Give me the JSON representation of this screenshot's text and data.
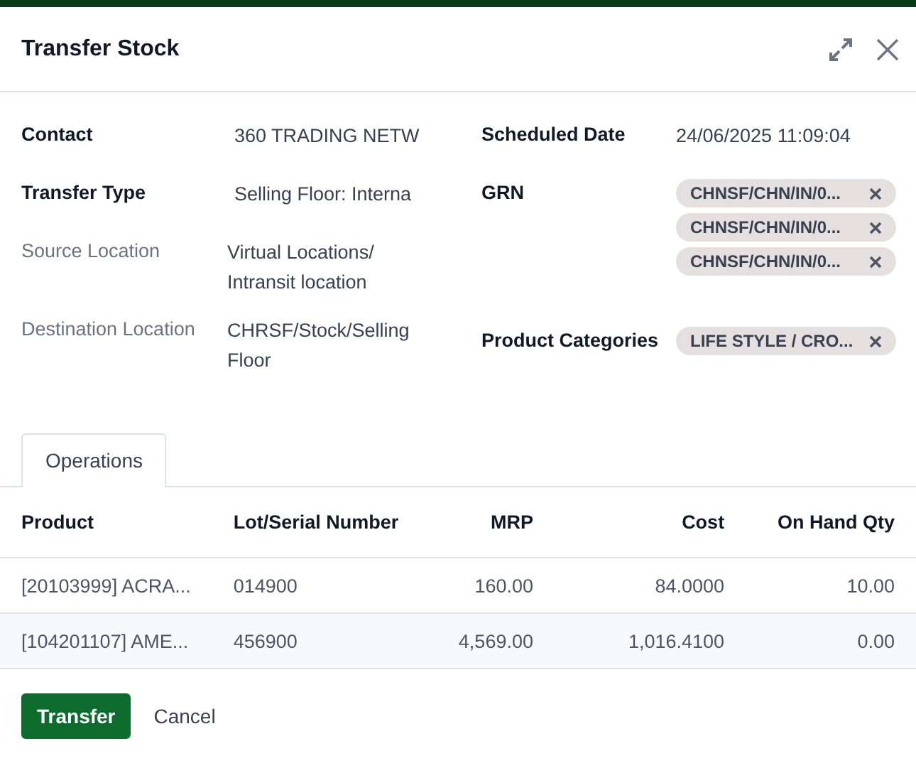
{
  "dialog": {
    "title": "Transfer Stock"
  },
  "left_fields": [
    {
      "label": "Contact",
      "value": "360 TRADING NETW",
      "readonly": false
    },
    {
      "label": "Transfer Type",
      "value": "Selling Floor: Interna",
      "readonly": false
    },
    {
      "label": "Source Location",
      "value": "Virtual Locations/ Intransit location",
      "readonly": true
    },
    {
      "label": "Destination Location",
      "value": "CHRSF/Stock/Selling Floor",
      "readonly": true
    }
  ],
  "right_fields": [
    {
      "label": "Scheduled Date",
      "kind": "text",
      "value": "24/06/2025 11:09:04"
    },
    {
      "label": "GRN",
      "kind": "tags",
      "tags": [
        "CHNSF/CHN/IN/0...",
        "CHNSF/CHN/IN/0...",
        "CHNSF/CHN/IN/0..."
      ]
    },
    {
      "label": "Product Categories",
      "kind": "tags",
      "tags": [
        "LIFE STYLE / CRO..."
      ]
    }
  ],
  "tabs": [
    {
      "label": "Operations",
      "selected": true
    }
  ],
  "table": {
    "columns": [
      "Product",
      "Lot/Serial Number",
      "MRP",
      "Cost",
      "On Hand Qty"
    ],
    "rows": [
      {
        "cells": [
          "[20103999] ACRA...",
          "014900",
          "160.00",
          "84.0000",
          "10.00"
        ]
      },
      {
        "cells": [
          "[104201107] AME...",
          "456900",
          "4,569.00",
          "1,016.4100",
          "0.00"
        ]
      }
    ]
  },
  "buttons": [
    {
      "label": "Transfer",
      "kind": "primary"
    },
    {
      "label": "Cancel",
      "kind": "secondary"
    }
  ]
}
